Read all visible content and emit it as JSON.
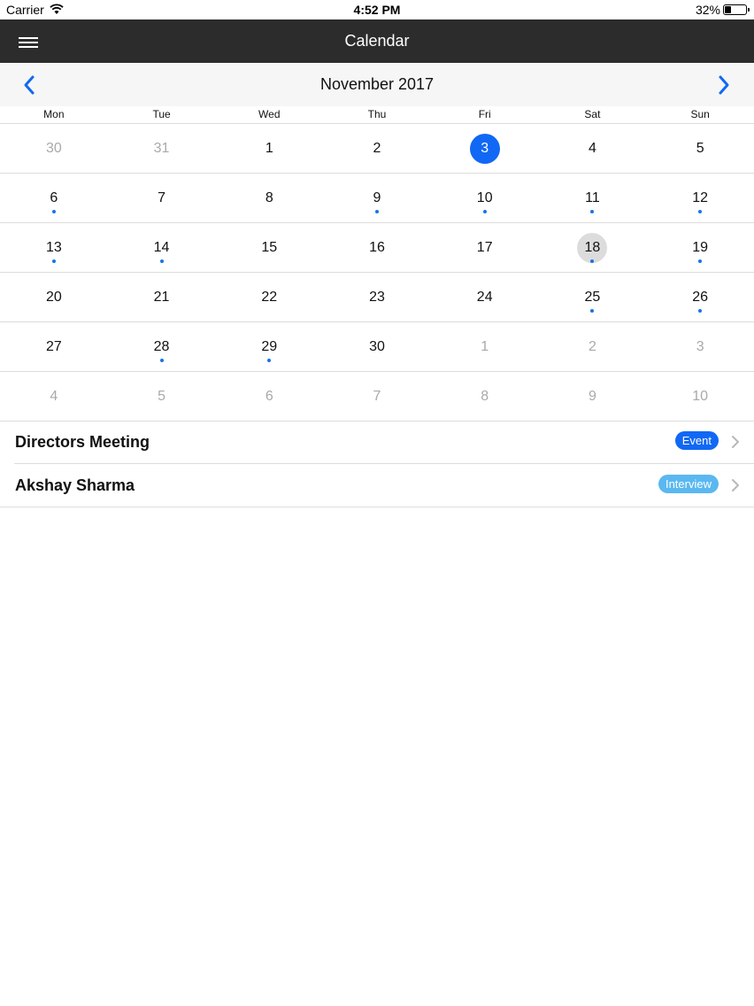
{
  "status": {
    "carrier": "Carrier",
    "time": "4:52 PM",
    "battery_percent": "32%",
    "battery_level": 0.32
  },
  "navbar": {
    "title": "Calendar",
    "menu_icon": "hamburger-menu-icon"
  },
  "month_nav": {
    "title": "November 2017",
    "prev_icon": "chevron-left-icon",
    "next_icon": "chevron-right-icon"
  },
  "weekdays": [
    "Mon",
    "Tue",
    "Wed",
    "Thu",
    "Fri",
    "Sat",
    "Sun"
  ],
  "weeks": [
    [
      {
        "d": "30",
        "muted": true
      },
      {
        "d": "31",
        "muted": true
      },
      {
        "d": "1"
      },
      {
        "d": "2"
      },
      {
        "d": "3",
        "selected": true
      },
      {
        "d": "4"
      },
      {
        "d": "5"
      }
    ],
    [
      {
        "d": "6",
        "dot": true
      },
      {
        "d": "7"
      },
      {
        "d": "8"
      },
      {
        "d": "9",
        "dot": true
      },
      {
        "d": "10",
        "dot": true
      },
      {
        "d": "11",
        "dot": true
      },
      {
        "d": "12",
        "dot": true
      }
    ],
    [
      {
        "d": "13",
        "dot": true
      },
      {
        "d": "14",
        "dot": true
      },
      {
        "d": "15"
      },
      {
        "d": "16"
      },
      {
        "d": "17"
      },
      {
        "d": "18",
        "dot": true,
        "highlight": true
      },
      {
        "d": "19",
        "dot": true
      }
    ],
    [
      {
        "d": "20"
      },
      {
        "d": "21"
      },
      {
        "d": "22"
      },
      {
        "d": "23"
      },
      {
        "d": "24"
      },
      {
        "d": "25",
        "dot": true
      },
      {
        "d": "26",
        "dot": true
      }
    ],
    [
      {
        "d": "27"
      },
      {
        "d": "28",
        "dot": true
      },
      {
        "d": "29",
        "dot": true
      },
      {
        "d": "30"
      },
      {
        "d": "1",
        "muted": true
      },
      {
        "d": "2",
        "muted": true
      },
      {
        "d": "3",
        "muted": true
      }
    ],
    [
      {
        "d": "4",
        "muted": true
      },
      {
        "d": "5",
        "muted": true
      },
      {
        "d": "6",
        "muted": true
      },
      {
        "d": "7",
        "muted": true
      },
      {
        "d": "8",
        "muted": true
      },
      {
        "d": "9",
        "muted": true
      },
      {
        "d": "10",
        "muted": true
      }
    ]
  ],
  "events": [
    {
      "name": "Directors Meeting",
      "badge": "Event",
      "badge_color": "#1168f4"
    },
    {
      "name": "Akshay Sharma",
      "badge": "Interview",
      "badge_color": "#5ab8f0"
    }
  ],
  "colors": {
    "accent": "#1168f4",
    "navbar": "#2b2c2b",
    "dot": "#1a73e8"
  }
}
